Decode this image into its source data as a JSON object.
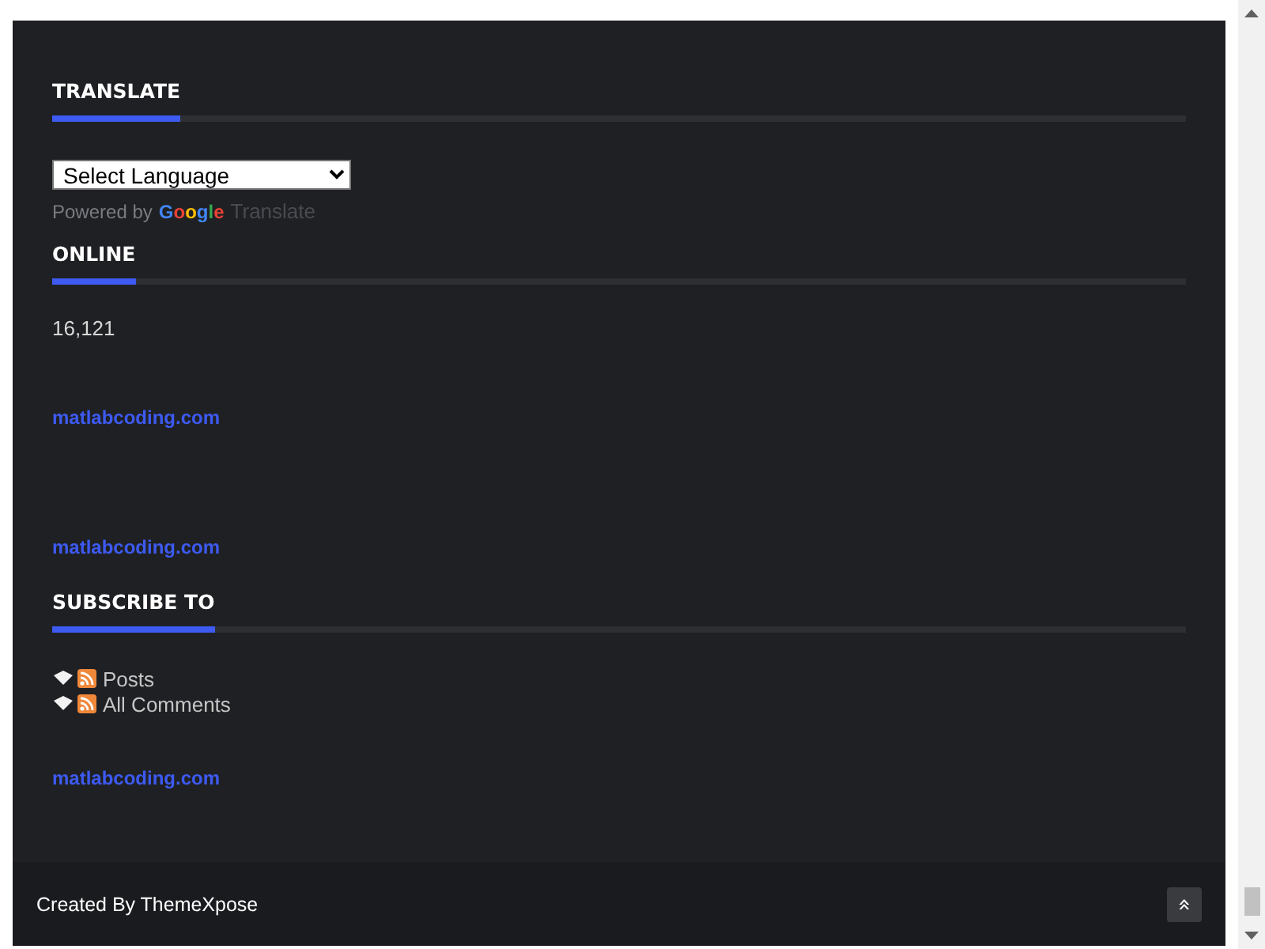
{
  "translate": {
    "title": "TRANSLATE",
    "select": {
      "value": "Select Language"
    },
    "powered_by": "Powered by",
    "google": "Google",
    "translate_word": "Translate"
  },
  "online": {
    "title": "ONLINE",
    "count": "16,121",
    "links": [
      "matlabcoding.com",
      "matlabcoding.com"
    ]
  },
  "subscribe": {
    "title": "SUBSCRIBE TO",
    "feeds": [
      "Posts",
      "All Comments"
    ],
    "link": "matlabcoding.com"
  },
  "footer": {
    "credit": "Created By ThemeXpose",
    "back_to_top": "»"
  }
}
